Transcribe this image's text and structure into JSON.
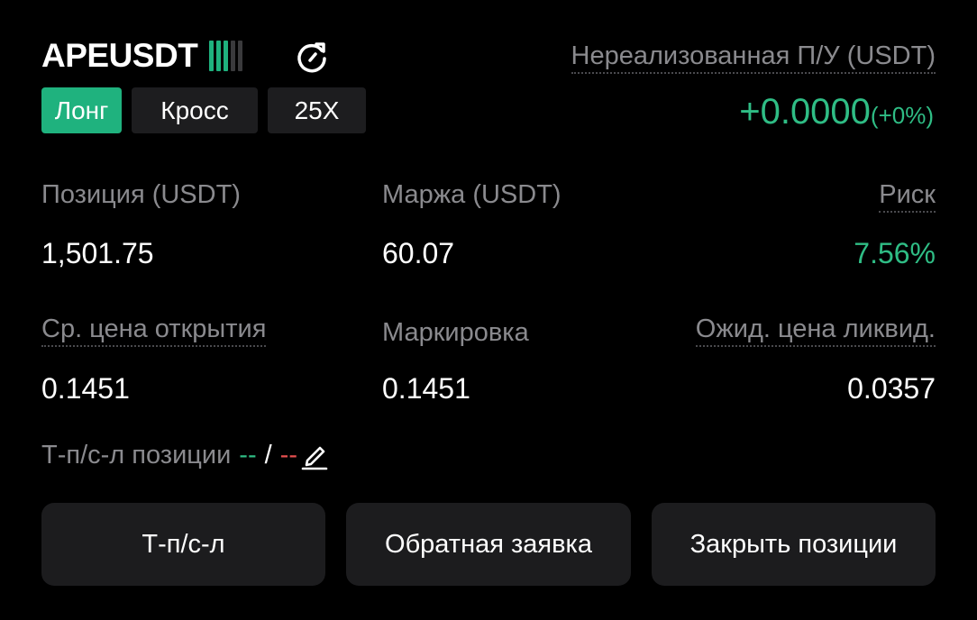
{
  "header": {
    "symbol": "APEUSDT",
    "strength_bars": {
      "filled": 3,
      "total": 5,
      "filled_color": "#1fb27e",
      "empty_color": "#3a3a3c"
    },
    "refresh_icon": "refresh-icon",
    "tags": {
      "side": "Лонг",
      "margin_mode": "Кросс",
      "leverage": "25X"
    }
  },
  "unrealized_pnl": {
    "label": "Нереализованная П/У (USDT)",
    "value": "+0.0000",
    "percent": "(+0%)"
  },
  "stats": {
    "position_label": "Позиция (USDT)",
    "position_value": "1,501.75",
    "margin_label": "Маржа (USDT)",
    "margin_value": "60.07",
    "risk_label": "Риск",
    "risk_value": "7.56%",
    "entry_price_label": "Ср. цена открытия",
    "entry_price_value": "0.1451",
    "mark_label": "Маркировка",
    "mark_value": "0.1451",
    "liq_price_label": "Ожид. цена ликвид.",
    "liq_price_value": "0.0357"
  },
  "tpsl": {
    "label": "Т-п/с-л позиции",
    "tp_value": "--",
    "separator": "/",
    "sl_value": "--",
    "edit_icon": "edit-pencil-icon"
  },
  "buttons": {
    "tpsl": "Т-п/с-л",
    "reverse": "Обратная заявка",
    "close": "Закрыть позиции"
  },
  "colors": {
    "accent_green": "#2fbd85",
    "tag_green": "#1fb27e",
    "loss_red": "#e64f4f",
    "surface": "#1c1c1e",
    "muted_text": "#8a8a8e"
  }
}
